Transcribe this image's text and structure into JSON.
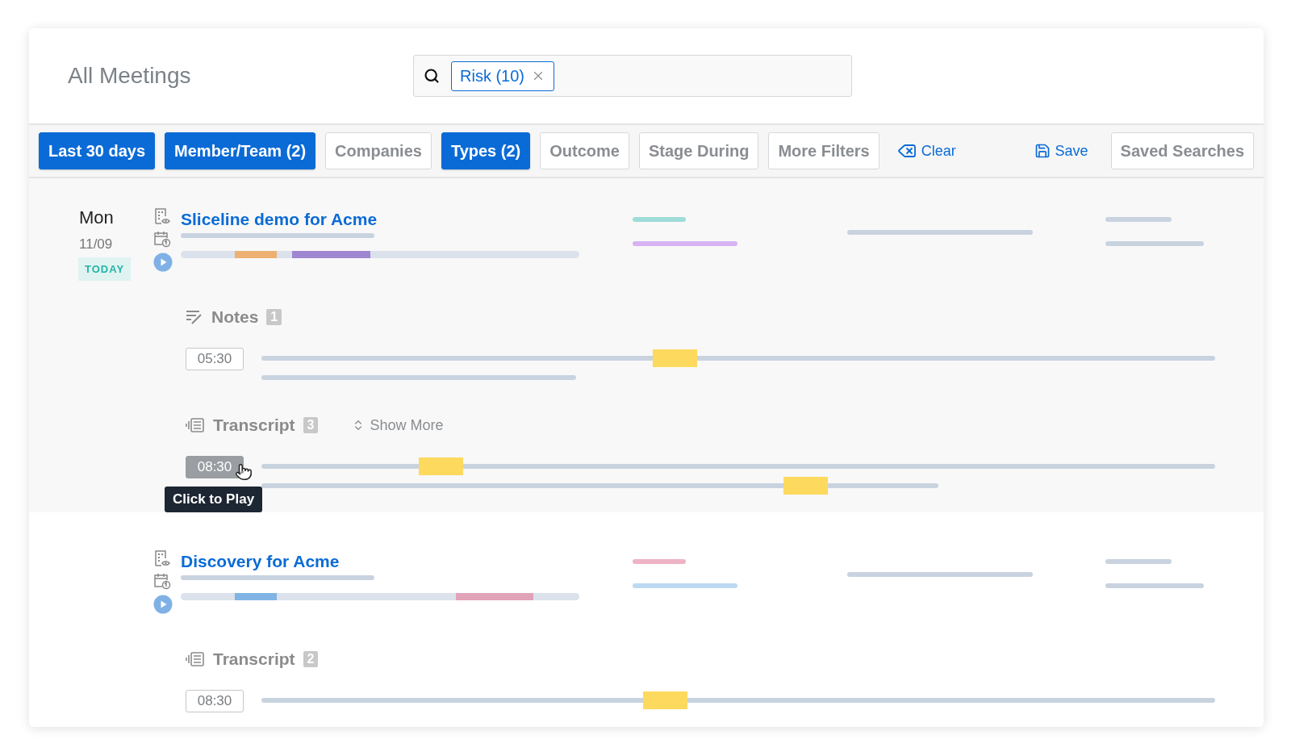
{
  "header": {
    "title": "All Meetings",
    "search": {
      "chips": [
        {
          "label": "Risk (10)"
        }
      ]
    }
  },
  "filters": [
    {
      "label": "Last 30 days",
      "selected": true
    },
    {
      "label": "Member/Team (2)",
      "selected": true
    },
    {
      "label": "Companies",
      "selected": false
    },
    {
      "label": "Types (2)",
      "selected": true
    },
    {
      "label": "Outcome",
      "selected": false
    },
    {
      "label": "Stage During",
      "selected": false
    },
    {
      "label": "More Filters",
      "selected": false
    }
  ],
  "actions": {
    "clear": "Clear",
    "save": "Save",
    "saved_searches": "Saved Searches"
  },
  "meetings": [
    {
      "day": "Mon",
      "date": "11/09",
      "badge": "TODAY",
      "title": "Sliceline demo for Acme",
      "highlighted": true,
      "sections": [
        {
          "kind": "notes",
          "label": "Notes",
          "count": "1",
          "entries": [
            {
              "time": "05:30",
              "active": false
            }
          ]
        },
        {
          "kind": "transcript",
          "label": "Transcript",
          "count": "3",
          "show_more": "Show More",
          "entries": [
            {
              "time": "08:30",
              "active": true,
              "tooltip": "Click to Play"
            }
          ]
        }
      ]
    },
    {
      "title": "Discovery for Acme",
      "highlighted": false,
      "sections": [
        {
          "kind": "transcript",
          "label": "Transcript",
          "count": "2",
          "entries": [
            {
              "time": "08:30",
              "active": false
            }
          ]
        }
      ]
    }
  ]
}
